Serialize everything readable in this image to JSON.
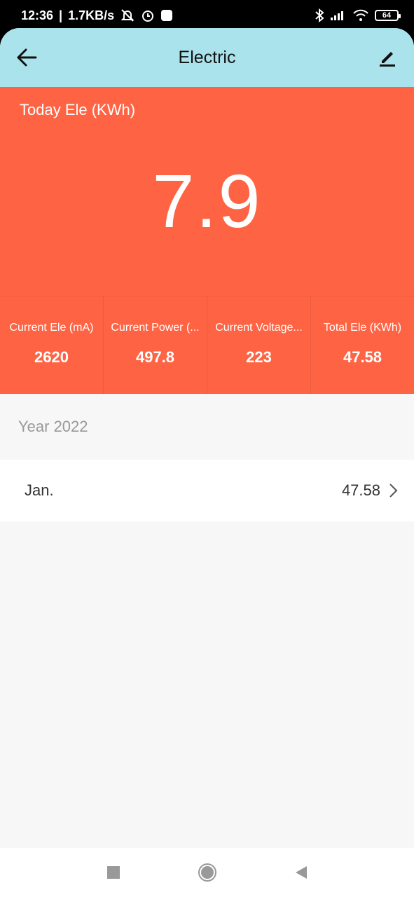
{
  "status_bar": {
    "time": "12:36",
    "network_speed": "1.7KB/s",
    "battery": "64"
  },
  "header": {
    "title": "Electric"
  },
  "today": {
    "label": "Today Ele (KWh)",
    "value": "7.9"
  },
  "metrics": [
    {
      "label": "Current Ele (mA)",
      "value": "2620"
    },
    {
      "label": "Current Power (...",
      "value": "497.8"
    },
    {
      "label": "Current Voltage...",
      "value": "223"
    },
    {
      "label": "Total Ele (KWh)",
      "value": "47.58"
    }
  ],
  "history": {
    "year_label": "Year 2022",
    "months": [
      {
        "name": "Jan.",
        "value": "47.58"
      }
    ]
  },
  "colors": {
    "header_bg": "#abe3ec",
    "panel_bg": "#fe6444",
    "page_bg": "#f7f7f7"
  }
}
